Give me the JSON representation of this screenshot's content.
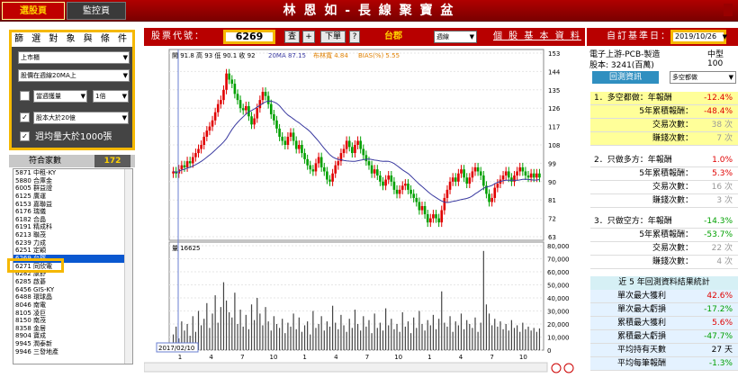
{
  "topbar": {
    "tab_active": "選股頁",
    "tab_inactive": "監控頁",
    "title": "林 恩 如 - 長 線 聚 寶 盆"
  },
  "filter": {
    "title": "篩 選 對 象 與 條 件",
    "market": "上市櫃",
    "cond1": "股價在週線20MA上",
    "cond2_check": false,
    "cond2_select": "當週獲量",
    "cond2_mult": "1倍",
    "cond3_check": true,
    "cond3_select": "股本大於20億",
    "cond4_check": true,
    "cond4_label": "週均量大於1000張"
  },
  "match": {
    "label": "符合家數",
    "count": "172"
  },
  "stocklist": [
    "5871 中租-KY",
    "5880 合庫金",
    "6005 群益證",
    "6125 廣運",
    "6153 嘉聯益",
    "6176 瑞儀",
    "6182 合晶",
    "6191 精成科",
    "6213 聯茂",
    "6239 力成",
    "6251 定穎",
    "6269 台郡",
    "6271 同欣電",
    "6282 康舒",
    "6285 啟碁",
    "6456 GIS-KY",
    "6488 環球晶",
    "8046 南電",
    "8105 凌巨",
    "8150 南茂",
    "8358 金居",
    "8904 寶成",
    "9945 潤泰新",
    "9946 三發地產"
  ],
  "selected_index": 11,
  "toolbar": {
    "code_label": "股票代號：",
    "code": "6269",
    "btn_query": "查",
    "btn_plus": "+",
    "btn_next": "下單",
    "btn_help": "?",
    "stock_name": "台郡",
    "period": "週線",
    "link": "個 股 基 本 資 料"
  },
  "chart_data": {
    "type": "candlestick",
    "title": "",
    "ohlc_header": "開 91.8  高 93  低 90.1  收 92",
    "ma_label": "20MA 87.15",
    "kd_label": "布林寬 4.84",
    "bias_label": "BIAS(%) 5.55",
    "volume_label": "量 16625",
    "price_axis": [
      "153",
      "144",
      "135",
      "126",
      "117",
      "108",
      "99",
      "90",
      "81",
      "72",
      "63"
    ],
    "volume_axis": [
      "80,000",
      "70,000",
      "60,000",
      "50,000",
      "40,000",
      "30,000",
      "20,000",
      "10,000",
      "0"
    ],
    "x_month_ticks": [
      "1",
      "4",
      "7",
      "10",
      "1",
      "4",
      "7",
      "10",
      "1",
      "4",
      "7",
      "10"
    ],
    "x_year_ticks": [
      "2017",
      "2018",
      "2019"
    ],
    "cursor_date": "2017/02/10",
    "ylim": [
      63,
      153
    ],
    "vol_lim": [
      0,
      80000
    ],
    "close_series": [
      95,
      94,
      96,
      98,
      97,
      100,
      99,
      102,
      104,
      106,
      108,
      112,
      115,
      117,
      120,
      124,
      128,
      130,
      135,
      143,
      140,
      138,
      133,
      130,
      126,
      125,
      127,
      122,
      118,
      121,
      126,
      130,
      134,
      132,
      128,
      123,
      120,
      116,
      112,
      110,
      108,
      112,
      114,
      110,
      106,
      108,
      104,
      101,
      98,
      96,
      95,
      99,
      102,
      97,
      95,
      91,
      90,
      94,
      98,
      100,
      104,
      106,
      110,
      107,
      104,
      108,
      110,
      106,
      103,
      100,
      98,
      94,
      96,
      93,
      90,
      88,
      91,
      93,
      90,
      86,
      84,
      86,
      88,
      89,
      86,
      84,
      82,
      80,
      76,
      78,
      74,
      70,
      72,
      74,
      72,
      70,
      76,
      82,
      86,
      90,
      92,
      90,
      94,
      96,
      92,
      89,
      92,
      95,
      97,
      95,
      93,
      88,
      84,
      80,
      82,
      87,
      89,
      91,
      93,
      95,
      92,
      90,
      93,
      95,
      97,
      95,
      93,
      92,
      94,
      92,
      94,
      92
    ],
    "volume_series": [
      12000,
      18000,
      9000,
      22000,
      15000,
      20000,
      11000,
      26000,
      14000,
      30000,
      19000,
      24000,
      36000,
      17000,
      28000,
      42000,
      21000,
      33000,
      52000,
      38000,
      29000,
      25000,
      44000,
      20000,
      31000,
      18000,
      27000,
      16000,
      35000,
      23000,
      40000,
      28000,
      19000,
      33000,
      22000,
      15000,
      26000,
      20000,
      17000,
      24000,
      13000,
      21000,
      18000,
      28000,
      16000,
      25000,
      14000,
      19000,
      22000,
      12000,
      30000,
      17000,
      20000,
      26000,
      15000,
      22000,
      18000,
      34000,
      21000,
      16000,
      27000,
      19000,
      14000,
      24000,
      17000,
      31000,
      20000,
      15000,
      26000,
      18000,
      23000,
      13000,
      28000,
      17000,
      21000,
      15000,
      32000,
      19000,
      24000,
      16000,
      20000,
      14000,
      29000,
      18000,
      22000,
      13000,
      25000,
      17000,
      30000,
      20000,
      15000,
      23000,
      19000,
      27000,
      16000,
      24000,
      45000,
      21000,
      18000,
      26000,
      14000,
      22000,
      19000,
      28000,
      16000,
      23000,
      20000,
      17000,
      25000,
      14000,
      21000,
      76000,
      35000,
      28000,
      19000,
      24000,
      18000,
      22000,
      16000,
      20000,
      15000,
      23000,
      17000,
      19000,
      14000,
      21000,
      16000,
      18000,
      15000,
      17000,
      14000,
      16625
    ]
  },
  "right": {
    "date_label": "自訂基準日：",
    "date": "2019/10/26",
    "industry": "電子上游-PCB-製造",
    "size": "中型100",
    "capital": "股本: 3241(百萬)",
    "backtest_label": "回測資訊",
    "backtest_select": "多空都做",
    "sec1": {
      "title": "1．多空都做：年報酬",
      "title_val": "-12.4%",
      "r1k": "5年累積報酬：",
      "r1v": "-48.4%",
      "r2k": "交易次數：",
      "r2v": "38 次",
      "r3k": "賺錢次數：",
      "r3v": "7 次"
    },
    "sec2": {
      "title": "2．只做多方：年報酬",
      "title_val": "1.0%",
      "r1k": "5年累積報酬：",
      "r1v": "5.3%",
      "r2k": "交易次數：",
      "r2v": "16 次",
      "r3k": "賺錢次數：",
      "r3v": "3 次"
    },
    "sec3": {
      "title": "3．只做空方：年報酬",
      "title_val": "-14.3%",
      "r1k": "5年累積報酬：",
      "r1v": "-53.7%",
      "r2k": "交易次數：",
      "r2v": "22 次",
      "r3k": "賺錢次數：",
      "r3v": "4 次"
    },
    "stats_title": "近 5 年回測資料結果統計",
    "stats": [
      {
        "k": "單次最大獲利",
        "v": "42.6%"
      },
      {
        "k": "單次最大虧損",
        "v": "-17.2%"
      },
      {
        "k": "累積最大獲利",
        "v": "5.6%"
      },
      {
        "k": "累積最大虧損",
        "v": "-47.7%"
      },
      {
        "k": "平均持有天數",
        "v": "27 天"
      },
      {
        "k": "平均每筆報酬",
        "v": "-1.3%"
      }
    ]
  }
}
